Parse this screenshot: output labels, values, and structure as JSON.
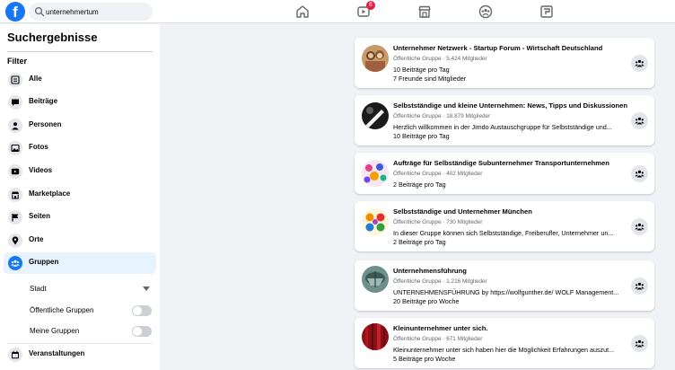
{
  "topbar": {
    "logo_letter": "f",
    "search": {
      "value": "unternehmertum"
    },
    "nav_icons": [
      "home-icon",
      "watch-icon",
      "marketplace-icon",
      "groups-icon",
      "gaming-icon"
    ],
    "watch_badge": "6"
  },
  "sidebar": {
    "title": "Suchergebnisse",
    "filter_heading": "Filter",
    "items": [
      {
        "label": "Alle",
        "icon": "all-results-icon"
      },
      {
        "label": "Beiträge",
        "icon": "posts-icon"
      },
      {
        "label": "Personen",
        "icon": "people-icon"
      },
      {
        "label": "Fotos",
        "icon": "photos-icon"
      },
      {
        "label": "Videos",
        "icon": "videos-icon"
      },
      {
        "label": "Marketplace",
        "icon": "marketplace-icon"
      },
      {
        "label": "Seiten",
        "icon": "pages-icon"
      },
      {
        "label": "Orte",
        "icon": "places-icon"
      },
      {
        "label": "Gruppen",
        "icon": "groups-icon",
        "active": true
      },
      {
        "label": "Veranstaltungen",
        "icon": "events-icon"
      }
    ],
    "group_filters": {
      "city_label": "Stadt",
      "public_groups_label": "Öffentliche Gruppen",
      "my_groups_label": "Meine Gruppen"
    }
  },
  "results": [
    {
      "title": "Unternehmer Netzwerk - Startup Forum - Wirtschaft Deutschland",
      "meta": "Öffentliche Gruppe · 5.424 Mitglieder",
      "line1": "10 Beiträge pro Tag",
      "line2": "7 Freunde sind Mitglieder"
    },
    {
      "title": "Selbstständige und kleine Unternehmen: News, Tipps und Diskussionen",
      "meta": "Öffentliche Gruppe · 18.879 Mitglieder",
      "line1": "Herzlich willkommen in der Jimdo Austauschgruppe für Selbstständige und...",
      "line2": "10 Beiträge pro Tag"
    },
    {
      "title": "Aufträge für Selbständige Subunternehmer Transportunternehmen",
      "meta": "Öffentliche Gruppe · 402 Mitglieder",
      "line1": "2 Beiträge pro Tag"
    },
    {
      "title": "Selbstständige und Unternehmer München",
      "meta": "Öffentliche Gruppe · 730 Mitglieder",
      "line1": "In dieser Gruppe können sich Selbstständige, Freiberufler, Unternehmer un...",
      "line2": "2 Beiträge pro Tag"
    },
    {
      "title": "Unternehmensführung",
      "meta": "Öffentliche Gruppe · 1.216 Mitglieder",
      "line1": "UNTERNEHMENSFÜHRUNG by https://wolfgunther.de/ WOLF Management...",
      "line2": "20 Beiträge pro Woche"
    },
    {
      "title": "Kleinunternehmer unter sich.",
      "meta": "Öffentliche Gruppe · 671 Mitglieder",
      "line1": "Kleinunternehmer unter sich haben hier die Möglichkeit Erfahrungen auszut...",
      "line2": "5 Beiträge pro Woche"
    }
  ],
  "colors": {
    "brand": "#1877f2",
    "background": "#f0f2f5",
    "active_bg": "#e7f3ff",
    "badge": "#e41e3f"
  }
}
